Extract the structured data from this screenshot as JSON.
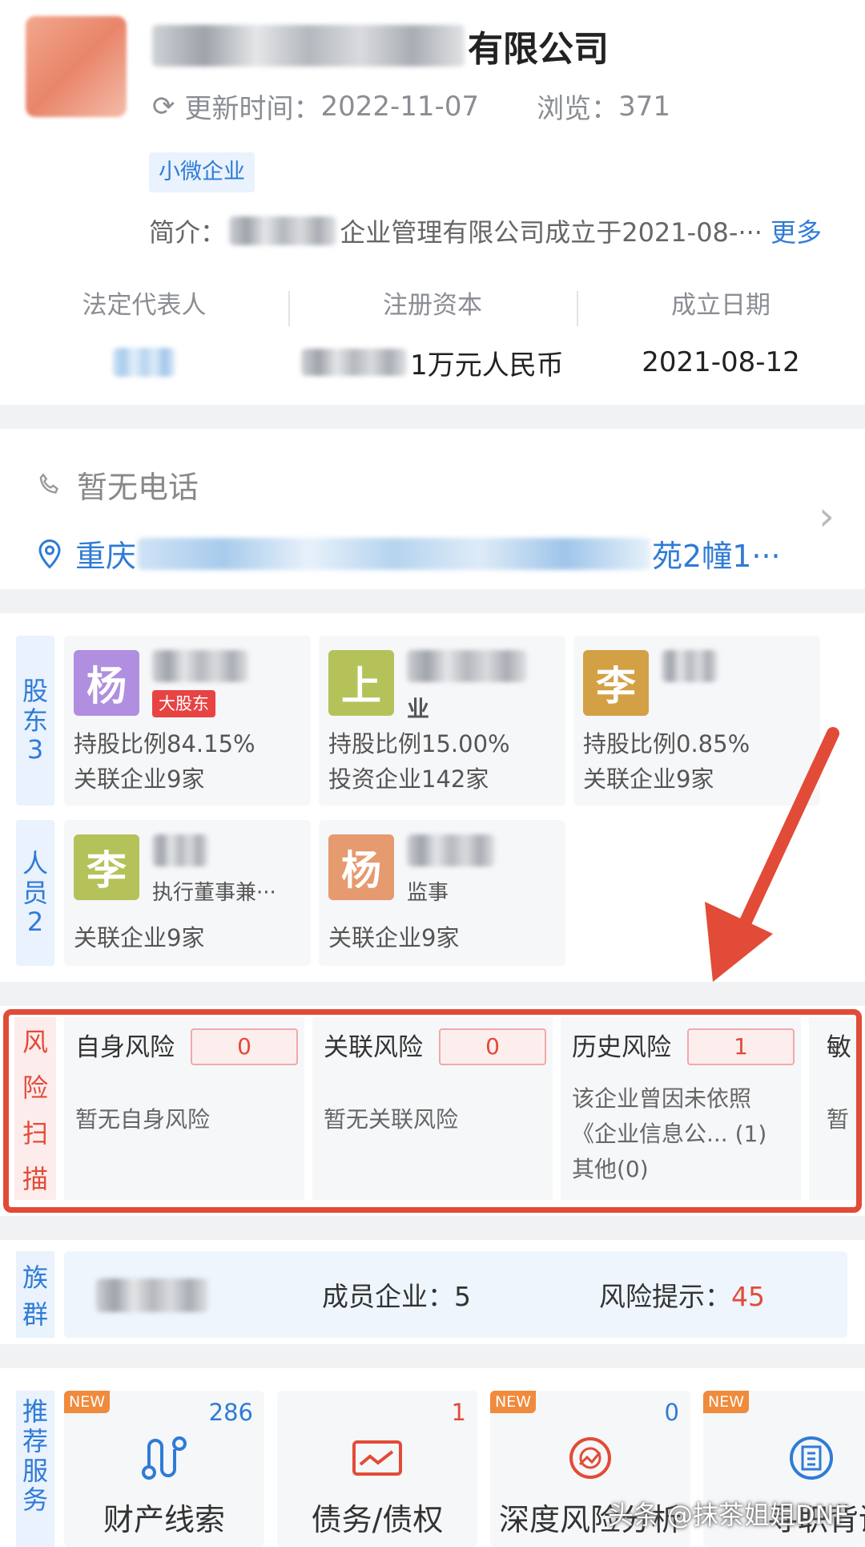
{
  "header": {
    "company_name_suffix": "有限公司",
    "update_label": "更新时间：",
    "update_date": "2022-11-07",
    "views_label": "浏览：",
    "views_count": "371",
    "tag": "小微企业",
    "intro_label": "简介：",
    "intro_text": "企业管理有限公司成立于2021-08-···",
    "more_link": "更多",
    "stats": [
      {
        "label": "法定代表人",
        "value": ""
      },
      {
        "label": "注册资本",
        "value": "1万元人民币"
      },
      {
        "label": "成立日期",
        "value": "2021-08-12"
      }
    ]
  },
  "contact": {
    "phone": "暂无电话",
    "address_prefix": "重庆",
    "address_suffix": "苑2幢1···"
  },
  "shareholders": {
    "side_label": "股东",
    "count": "3",
    "items": [
      {
        "avatar": "杨",
        "color": "#b08ee0",
        "badge": "大股东",
        "line1": "持股比例84.15%",
        "line2": "关联企业9家"
      },
      {
        "avatar": "上",
        "color": "#b5c25a",
        "role": "业",
        "line1": "持股比例15.00%",
        "line2": "投资企业142家"
      },
      {
        "avatar": "李",
        "color": "#d4a045",
        "line1": "持股比例0.85%",
        "line2": "关联企业9家"
      }
    ]
  },
  "staff": {
    "side_label": "人员",
    "count": "2",
    "items": [
      {
        "avatar": "李",
        "color": "#b5c25a",
        "role": "执行董事兼···",
        "line1": "关联企业9家"
      },
      {
        "avatar": "杨",
        "color": "#e59a6f",
        "role": "监事",
        "line1": "关联企业9家"
      }
    ]
  },
  "risk": {
    "side_label": [
      "风",
      "险",
      "扫",
      "描"
    ],
    "items": [
      {
        "title": "自身风险",
        "count": "0",
        "desc": "暂无自身风险"
      },
      {
        "title": "关联风险",
        "count": "0",
        "desc": "暂无关联风险"
      },
      {
        "title": "历史风险",
        "count": "1",
        "desc_lines": [
          "该企业曾因未依照",
          "《企业信息公... (1)",
          "其他(0)"
        ]
      },
      {
        "title": "敏",
        "desc": "暂"
      }
    ]
  },
  "group": {
    "side_label": [
      "族",
      "群"
    ],
    "members_label": "成员企业：",
    "members_count": "5",
    "risk_label": "风险提示：",
    "risk_count": "45"
  },
  "services": {
    "side_label": [
      "推",
      "荐",
      "服",
      "务"
    ],
    "new_badge": "NEW",
    "items": [
      {
        "label": "财产线索",
        "count": "286",
        "icon": "route-icon"
      },
      {
        "label": "债务/债权",
        "count": "1",
        "icon": "document-money-icon"
      },
      {
        "label": "深度风险分析",
        "count": "0",
        "icon": "radar-icon"
      },
      {
        "label": "寻职背调",
        "count": "",
        "icon": "building-icon"
      }
    ]
  },
  "watermark": "头条 @抹茶姐姐DNF",
  "colors": {
    "accent": "#2f7bd6",
    "risk_red": "#e24b37",
    "new_orange": "#f08a3c"
  }
}
